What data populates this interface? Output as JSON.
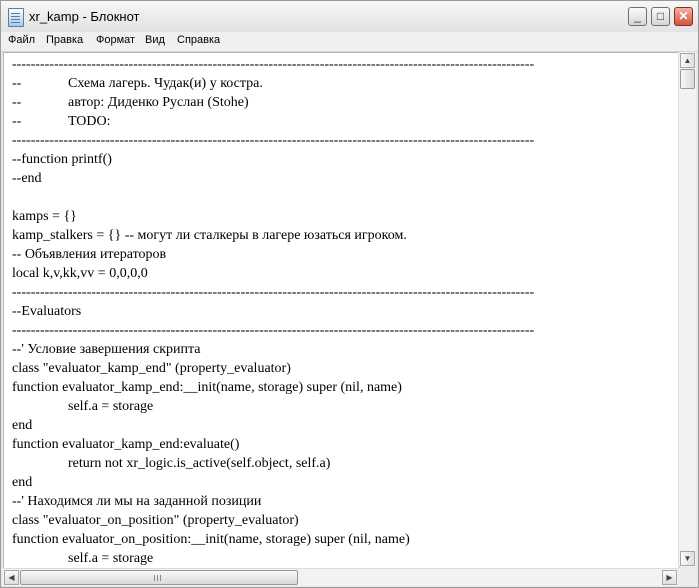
{
  "window": {
    "title": "xr_kamp - Блокнот",
    "icon": "notepad-icon",
    "buttons": {
      "minimize": "_",
      "maximize": "□",
      "close": "✕"
    }
  },
  "menu": [
    {
      "label": "Файл"
    },
    {
      "label": "Правка"
    },
    {
      "label": "Формат"
    },
    {
      "label": "Вид"
    },
    {
      "label": "Справка"
    }
  ],
  "editor": {
    "lines": [
      "----------------------------------------------------------------------------------------------------------------",
      "--\t\tСхема лагерь. Чудак(и) у костра.",
      "--\t\tавтор: Диденко Руслан (Stohe)",
      "--\t\tTODO:",
      "----------------------------------------------------------------------------------------------------------------",
      "--function printf()",
      "--end",
      "",
      "kamps = {}",
      "kamp_stalkers = {} -- могут ли сталкеры в лагере юзаться игроком.",
      "-- Объявления итераторов",
      "local k,v,kk,vv = 0,0,0,0",
      "----------------------------------------------------------------------------------------------------------------",
      "--Evaluators",
      "----------------------------------------------------------------------------------------------------------------",
      "--' Условие завершения скрипта",
      "class \"evaluator_kamp_end\" (property_evaluator)",
      "function evaluator_kamp_end:__init(name, storage) super (nil, name)",
      "\t\tself.a = storage",
      "end",
      "function evaluator_kamp_end:evaluate()",
      "\t\treturn not xr_logic.is_active(self.object, self.a)",
      "end",
      "--' Находимся ли мы на заданной позиции",
      "class \"evaluator_on_position\" (property_evaluator)",
      "function evaluator_on_position:__init(name, storage) super (nil, name)",
      "\t\tself.a = storage"
    ]
  },
  "scrollbars": {
    "vertical": {
      "up_arrow": "▲",
      "down_arrow": "▼"
    },
    "horizontal": {
      "left_arrow": "◀",
      "right_arrow": "▶"
    }
  }
}
